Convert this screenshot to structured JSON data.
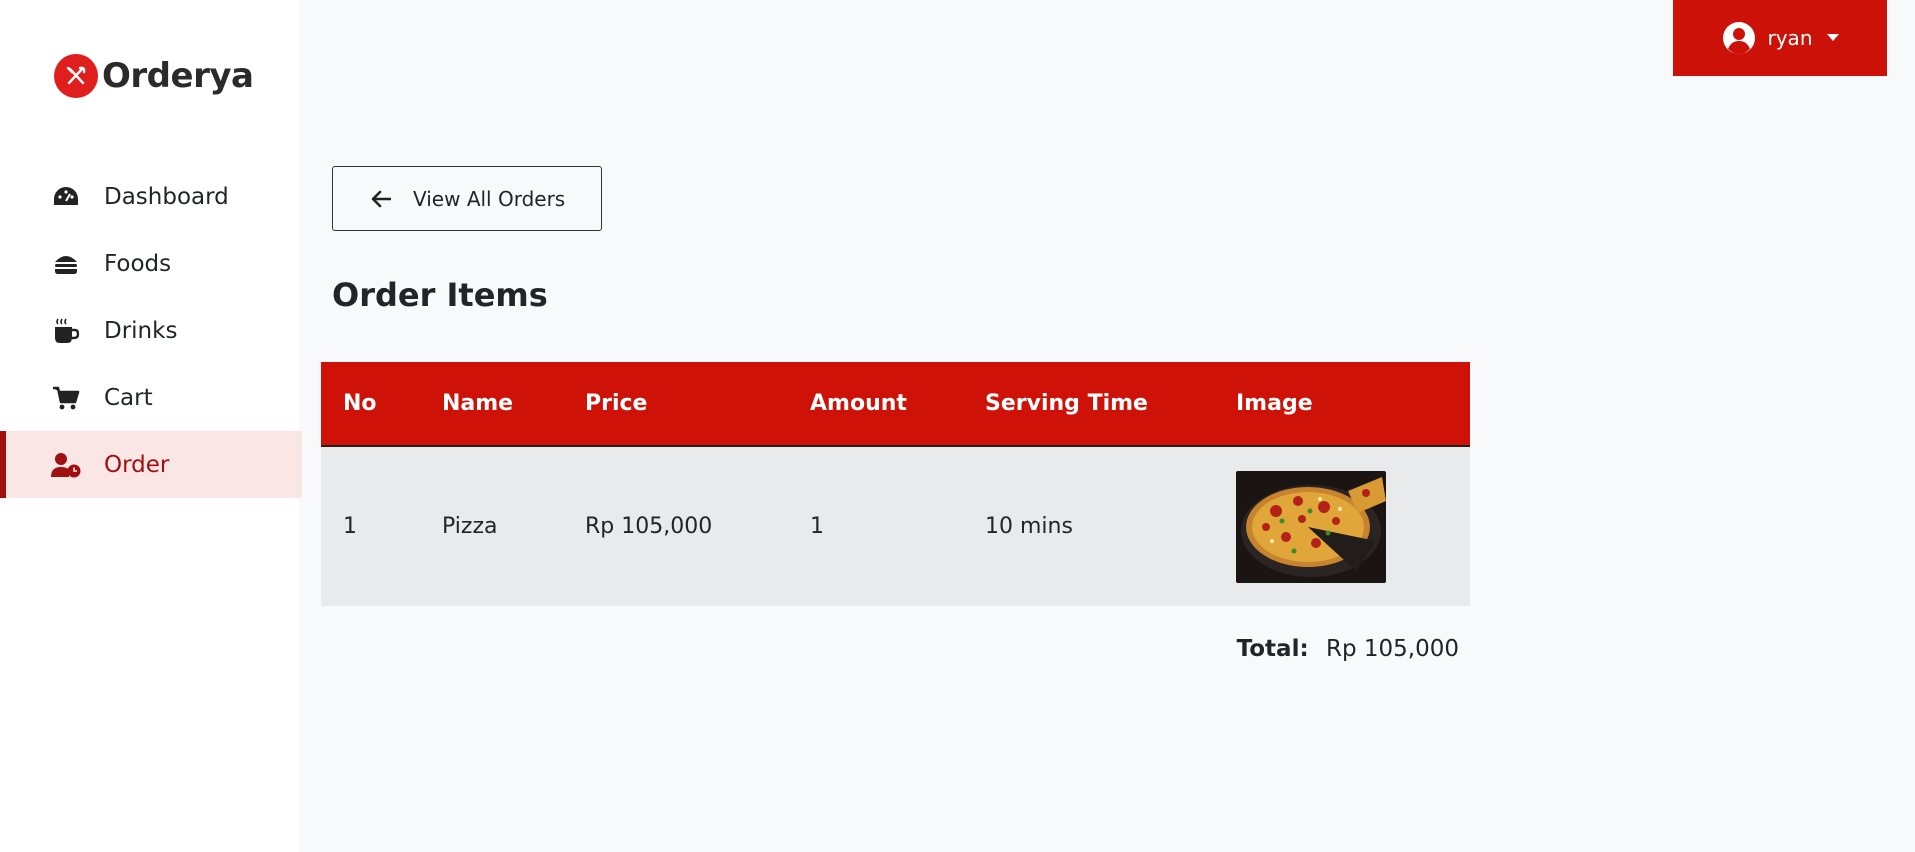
{
  "brand": {
    "name": "Orderya"
  },
  "sidebar": {
    "items": [
      {
        "label": "Dashboard",
        "icon": "dashboard-gauge-icon",
        "active": false
      },
      {
        "label": "Foods",
        "icon": "burger-icon",
        "active": false
      },
      {
        "label": "Drinks",
        "icon": "mug-icon",
        "active": false
      },
      {
        "label": "Cart",
        "icon": "cart-icon",
        "active": false
      },
      {
        "label": "Order",
        "icon": "user-clock-icon",
        "active": true
      }
    ]
  },
  "header": {
    "username": "ryan"
  },
  "main": {
    "back_label": "View All Orders",
    "title": "Order Items",
    "table": {
      "columns": [
        "No",
        "Name",
        "Price",
        "Amount",
        "Serving Time",
        "Image"
      ],
      "rows": [
        {
          "no": "1",
          "name": "Pizza",
          "price": "Rp 105,000",
          "amount": "1",
          "serving_time": "10 mins",
          "image": "pizza-image"
        }
      ]
    },
    "total_label": "Total:",
    "total_value": "Rp 105,000"
  },
  "colors": {
    "brand_red": "#cf1208",
    "active_bg": "#fbe6e6",
    "active_text": "#a11010"
  }
}
